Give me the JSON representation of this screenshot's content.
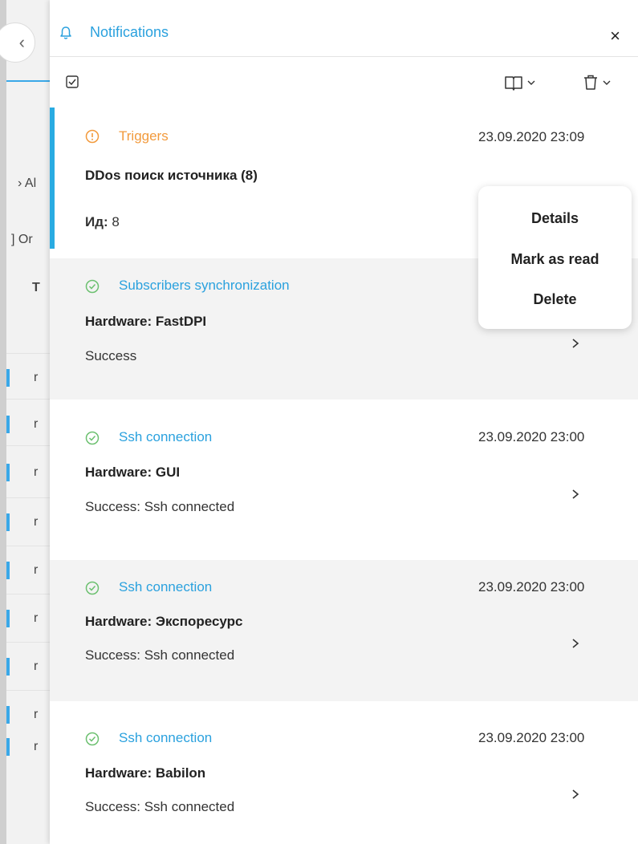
{
  "panel": {
    "title": "Notifications",
    "close_label": "×"
  },
  "background": {
    "frag1": "Al",
    "frag2": "Or",
    "frag3": "T",
    "row_letter": "r"
  },
  "notifications": [
    {
      "category": "Triggers",
      "category_type": "trigger",
      "timestamp": "23.09.2020 23:09",
      "title": "DDos поиск источника (8)",
      "id_label": "Ид:",
      "id_value": "8",
      "selected": true
    },
    {
      "category": "Subscribers synchronization",
      "category_type": "success",
      "timestamp": "",
      "title": "Hardware: FastDPI",
      "description": "Success"
    },
    {
      "category": "Ssh connection",
      "category_type": "success",
      "timestamp": "23.09.2020 23:00",
      "title": "Hardware: GUI",
      "description": "Success: Ssh connected"
    },
    {
      "category": "Ssh connection",
      "category_type": "success",
      "timestamp": "23.09.2020 23:00",
      "title": "Hardware: Экспоресурс",
      "description": "Success: Ssh connected"
    },
    {
      "category": "Ssh connection",
      "category_type": "success",
      "timestamp": "23.09.2020 23:00",
      "title": "Hardware: Babilon",
      "description": "Success: Ssh connected"
    }
  ],
  "context_menu": {
    "details": "Details",
    "mark_as_read": "Mark as read",
    "delete": "Delete"
  },
  "icons": {
    "header": "bell-icon",
    "select_all": "checkbox-icon",
    "mark_menu": "book-icon",
    "delete_menu": "trash-icon",
    "trigger": "warning-circle-icon",
    "success": "check-circle-icon",
    "item_action": "chevron-right-icon"
  },
  "colors": {
    "accent": "#2aa1de",
    "selected_bar": "#29abe2",
    "warning": "#f29a3c",
    "success": "#6cc070",
    "shaded_row": "#f3f3f3"
  }
}
